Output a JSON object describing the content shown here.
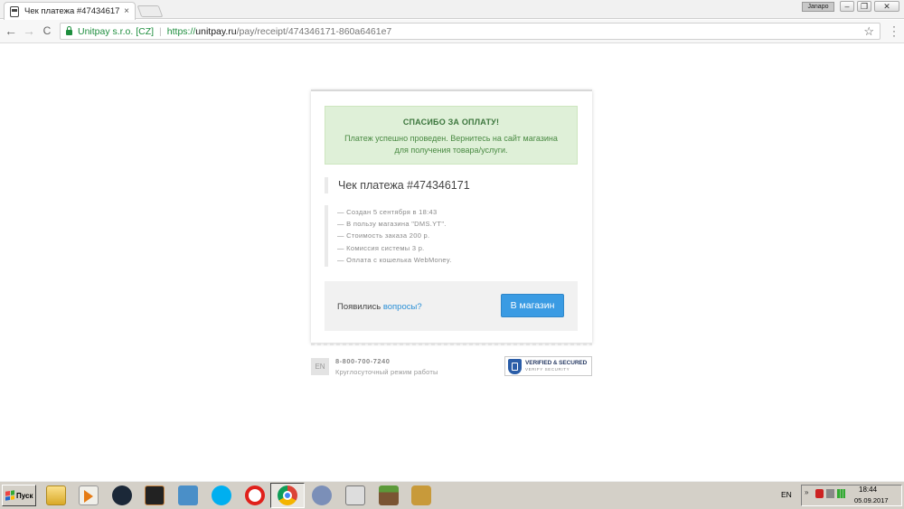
{
  "browser": {
    "tab_title": "Чек платежа #474346171",
    "tab_close": "×",
    "profile_label": "Janapo",
    "window_buttons": [
      "–",
      "❐",
      "✕"
    ],
    "ev_name": "Unitpay s.r.o. [CZ]",
    "url_scheme": "https://",
    "url_host": "unitpay.ru",
    "url_path": "/pay/receipt/474346171-860a6461e7",
    "back_glyph": "←",
    "forward_glyph": "→",
    "reload_glyph": "C",
    "star_glyph": "☆"
  },
  "page": {
    "success_title": "СПАСИБО ЗА ОПЛАТУ!",
    "success_text": "Платеж успешно проведен. Вернитесь на сайт магазина для получения товара/услуги.",
    "receipt_title": "Чек платежа #474346171",
    "details": [
      "— Создан 5 сентября в 18:43",
      "— В пользу магазина \"DMS.YT\".",
      "— Стоимость заказа 200 р.",
      "— Комиссия системы 3 р.",
      "— Оплата с кошелька WebMoney."
    ],
    "questions_prefix": "Появились ",
    "questions_link": "вопросы?",
    "shop_button": "В магазин",
    "lang": "EN",
    "phone": "8-800-700-7240",
    "hours": "Круглосуточный режим работы",
    "verified_title": "VERIFIED & SECURED",
    "verified_sub": "VERIFY SECURITY"
  },
  "taskbar": {
    "start_label": "Пуск",
    "tray_lang": "EN",
    "clock_time": "18:44",
    "clock_date": "05.09.2017",
    "icons": [
      "explorer-icon",
      "media-player-icon",
      "steam-icon",
      "game-icon",
      "vk-icon",
      "skype-icon",
      "opera-icon",
      "chrome-icon",
      "tor-icon",
      "skyrim-icon",
      "minecraft-icon",
      "game2-icon"
    ]
  },
  "colors": {
    "accent": "#3a9be3",
    "success_bg": "#dff0d8",
    "success_text": "#3c763d",
    "ev_green": "#1e8e3e"
  }
}
